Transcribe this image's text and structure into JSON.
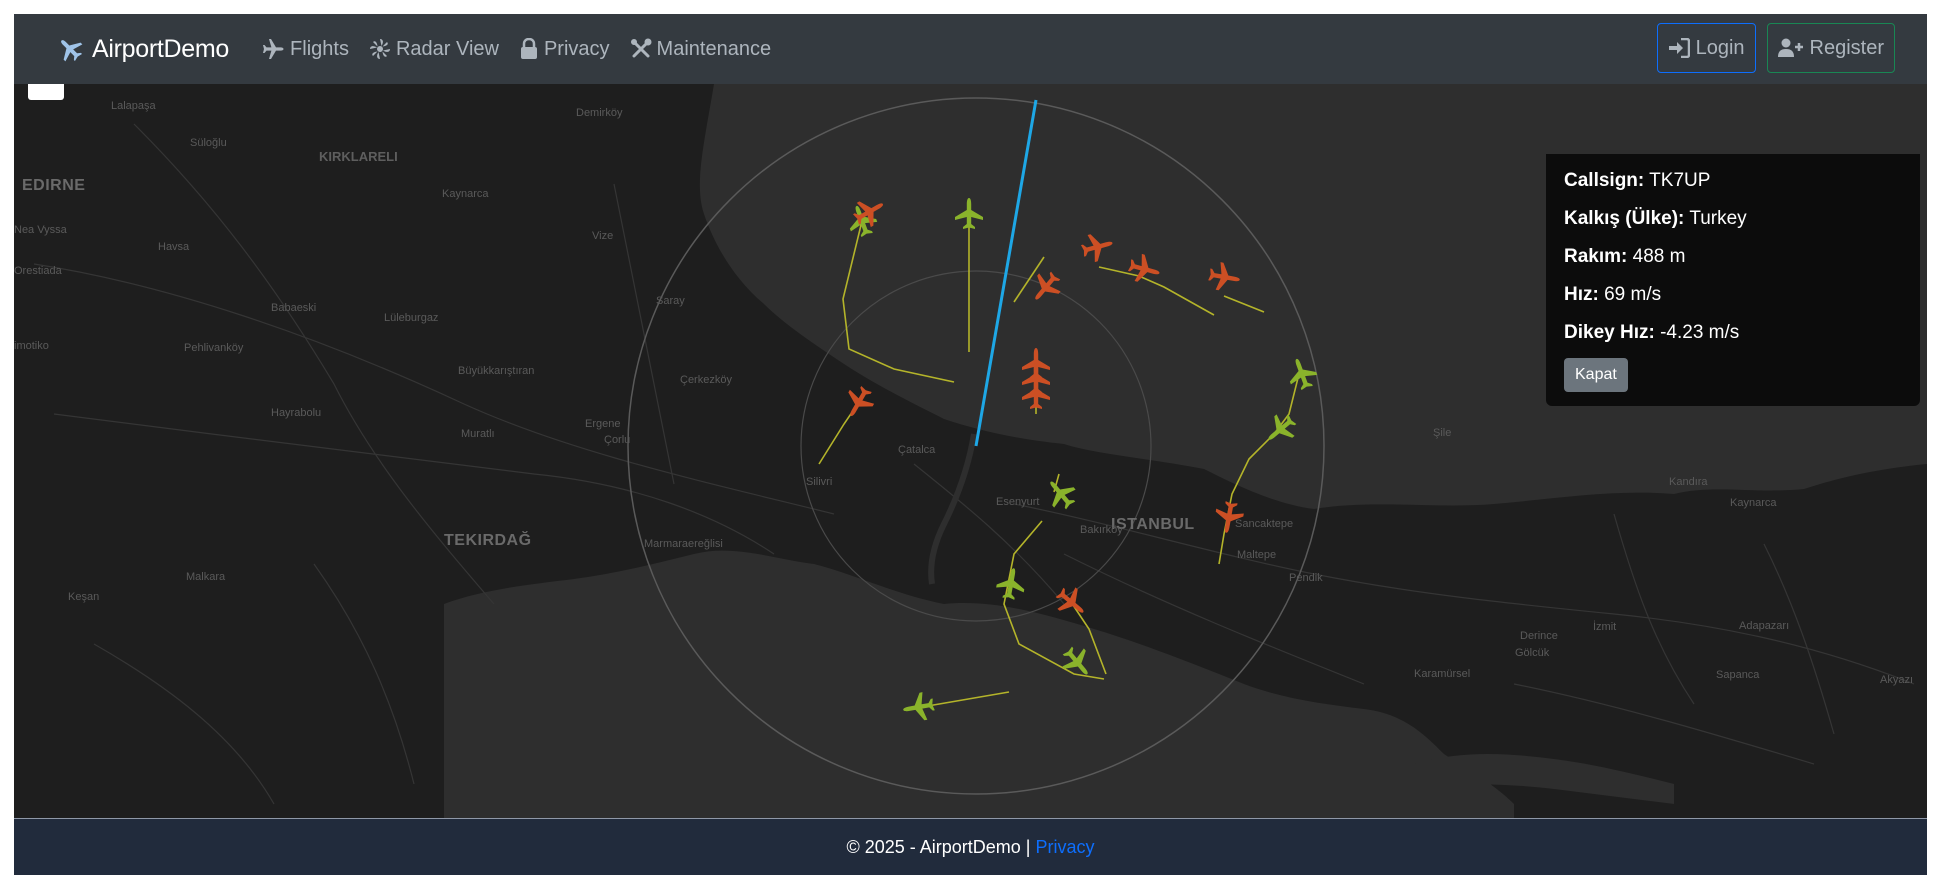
{
  "navbar": {
    "brand": "AirportDemo",
    "links": [
      {
        "label": "Flights",
        "icon": "plane-icon"
      },
      {
        "label": "Radar View",
        "icon": "radar-fan-icon"
      },
      {
        "label": "Privacy",
        "icon": "lock-icon"
      },
      {
        "label": "Maintenance",
        "icon": "tools-icon"
      }
    ],
    "login_label": "Login",
    "register_label": "Register"
  },
  "map": {
    "places": {
      "edirne": "EDIRNE",
      "kirklareli": "KIRKLARELI",
      "tekirdag": "TEKIRDAĞ",
      "istanbul": "ISTANBUL",
      "lalapasa": "Lalapaşa",
      "suloglu": "Süloğlu",
      "demirkoy": "Demirköy",
      "kaynarca": "Kaynarca",
      "vize": "Vize",
      "havsa": "Havsa",
      "nea_vyssa": "Nea Vyssa",
      "orestiada": "Orestiada",
      "babaeski": "Babaeski",
      "luleburgaz": "Lüleburgaz",
      "saray": "Saray",
      "pehlivankoy": "Pehlivanköy",
      "buyukkaristiran": "Büyükkarıştıran",
      "cerkezkoy": "Çerkezköy",
      "hayrabolu": "Hayrabolu",
      "muratli": "Muratlı",
      "ergene": "Ergene",
      "corlu": "Çorlu",
      "catalca": "Çatalca",
      "silivri": "Silivri",
      "marmaraereglisi": "Marmaraereğlisi",
      "malkara": "Malkara",
      "kesan": "Keşan",
      "esenyurt": "Esenyurt",
      "bakirkoy": "Bakırköy",
      "sancaktepe": "Sancaktepe",
      "maltepe": "Maltepe",
      "pendik": "Pendik",
      "sile": "Şile",
      "kandira": "Kandıra",
      "kaynarca2": "Kaynarca",
      "derince": "Derince",
      "izmit": "İzmit",
      "golcuk": "Gölcük",
      "adapazari": "Adapazarı",
      "karamursel": "Karamürsel",
      "sapanca": "Sapanca",
      "akyazi": "Akyazı",
      "micotiko": "imotiko"
    }
  },
  "info_panel": {
    "callsign_label": "Callsign:",
    "callsign_value": "TK7UP",
    "departure_label": "Kalkış (Ülke):",
    "departure_value": "Turkey",
    "altitude_label": "Rakım:",
    "altitude_value": "488 m",
    "speed_label": "Hız:",
    "speed_value": "69 m/s",
    "vspeed_label": "Dikey Hız:",
    "vspeed_value": "-4.23 m/s",
    "close_label": "Kapat"
  },
  "footer": {
    "copyright": "© 2025 - AirportDemo | ",
    "privacy_link": "Privacy"
  },
  "colors": {
    "navbar_bg": "#343a40",
    "map_bg": "#262626",
    "land": "#1e1e1e",
    "sea": "#2f2f2f",
    "arriving_plane": "#cc4f24",
    "departing_plane": "#8ab32b",
    "trail": "#b4b42a",
    "radar_sweep": "#1ea7e6",
    "footer_bg": "#212b3c",
    "link_blue": "#0d6efd"
  }
}
